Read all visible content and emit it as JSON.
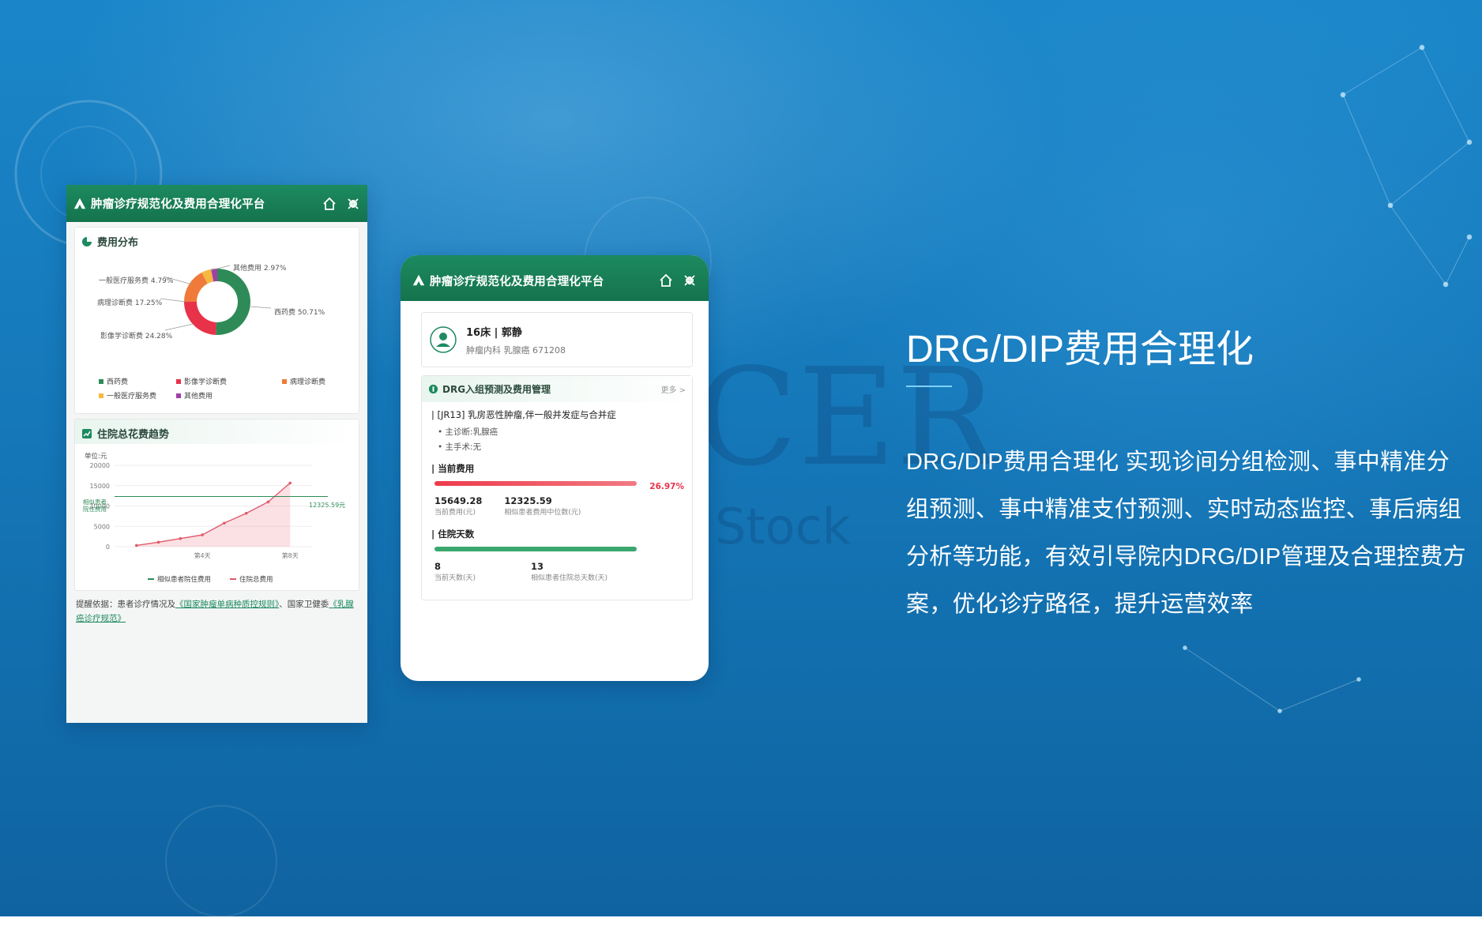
{
  "background": {
    "watermark": "CER",
    "watermark_sub": "Stock"
  },
  "phone1": {
    "header": {
      "title": "肿瘤诊疗规范化及费用合理化平台"
    },
    "cost_distribution": {
      "title": "费用分布",
      "segments": [
        {
          "label": "西药费",
          "percent_label": "50.71%",
          "value": 50.71,
          "color": "#2e8b57"
        },
        {
          "label": "影像学诊断费",
          "percent_label": "24.28%",
          "value": 24.28,
          "color": "#e8324a"
        },
        {
          "label": "病理诊断费",
          "percent_label": "17.25%",
          "value": 17.25,
          "color": "#f07a3a"
        },
        {
          "label": "一般医疗服务费",
          "percent_label": "4.79%",
          "value": 4.79,
          "color": "#f5b840"
        },
        {
          "label": "其他费用",
          "percent_label": "2.97%",
          "value": 2.97,
          "color": "#a23ea8"
        }
      ],
      "callouts": {
        "other": "其他费用 2.97%",
        "general": "一般医疗服务费 4.79%",
        "pathology": "病理诊断费 17.25%",
        "imaging": "影像学诊断费 24.28%",
        "western": "西药费 50.71%"
      },
      "legend": [
        "西药费",
        "影像学诊断费",
        "病理诊断费",
        "一般医疗服务费",
        "其他费用"
      ]
    },
    "trend": {
      "title": "住院总花费趋势",
      "unit": "单位:元",
      "y_ticks": [
        "20000",
        "15000",
        "10000",
        "5000",
        "0"
      ],
      "ref_label_left": "相似患者\n院住费用",
      "ref_label_left_1": "相似患者",
      "ref_label_left_2": "院住费用",
      "ref_value_label": "12325.59元",
      "x_ticks": [
        "第4天",
        "第8天"
      ],
      "legend": [
        "相似患者院住费用",
        "住院总费用"
      ]
    },
    "note": {
      "prefix": "提醒依据：患者诊疗情况及",
      "link1": "《国家肿瘤单病种质控规则》",
      "middle": "、国家卫健委",
      "link2": "《乳腺癌诊疗规范》"
    }
  },
  "phone2": {
    "header": {
      "title": "肿瘤诊疗规范化及费用合理化平台"
    },
    "patient": {
      "bed_name": "16床 | 郭静",
      "meta": "肿瘤内科   乳腺癌   671208"
    },
    "drg": {
      "title": "DRG入组预测及费用管理",
      "more": "更多 >",
      "group": "| [JR13] 乳房恶性肿瘤,伴一般并发症与合并症",
      "diagnosis": "• 主诊断:乳腺癌",
      "surgery": "• 主手术:无",
      "cost_title": "| 当前费用",
      "cost_percent": "26.97%",
      "current_cost": "15649.28",
      "current_cost_caption": "当前费用(元)",
      "median_cost": "12325.59",
      "median_cost_caption": "相似患者费用中位数(元)",
      "days_title": "| 住院天数",
      "current_days": "8",
      "current_days_caption": "当前天数(天)",
      "similar_days": "13",
      "similar_days_caption": "相似患者住院总天数(天)"
    }
  },
  "feature": {
    "title": "DRG/DIP费用合理化",
    "description": "DRG/DIP费用合理化 实现诊间分组检测、事中精准分组预测、事中精准支付预测、实时动态监控、事后病组分析等功能，有效引导院内DRG/DIP管理及合理控费方案，优化诊疗路径，提升运营效率"
  },
  "chart_data": {
    "type": "line",
    "title": "住院总花费趋势",
    "ylabel": "单位:元",
    "ylim": [
      0,
      20000
    ],
    "x_tick_labels": [
      "第4天",
      "第8天"
    ],
    "series": [
      {
        "name": "住院总费用",
        "x": [
          1,
          2,
          3,
          4,
          5,
          6,
          7,
          8
        ],
        "values": [
          300,
          1100,
          2000,
          2900,
          5800,
          8200,
          11000,
          15649.28
        ],
        "color": "#e05a6a"
      },
      {
        "name": "相似患者院住费用",
        "x": [
          1,
          8
        ],
        "values": [
          12325.59,
          12325.59
        ],
        "color": "#2e8b57"
      }
    ]
  }
}
